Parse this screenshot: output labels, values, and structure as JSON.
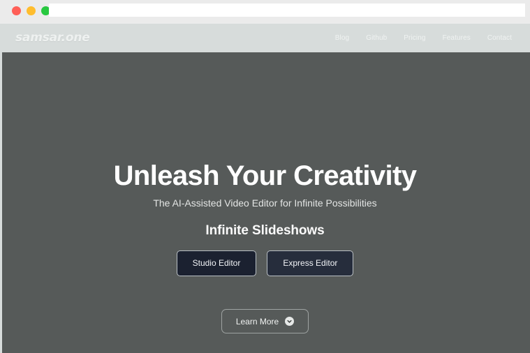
{
  "browser": {
    "traffic_lights": [
      {
        "name": "close",
        "color": "#ff5f57"
      },
      {
        "name": "minimize",
        "color": "#ffbd2e"
      },
      {
        "name": "maximize",
        "color": "#28c840"
      }
    ],
    "address_bar": {
      "value": "",
      "placeholder": ""
    }
  },
  "site": {
    "brand": "samsar.one",
    "nav": [
      {
        "label": "Blog"
      },
      {
        "label": "Github"
      },
      {
        "label": "Pricing"
      },
      {
        "label": "Features"
      },
      {
        "label": "Contact"
      }
    ],
    "nav_bg": "#d7dcdb"
  },
  "hero": {
    "title": "Unleash Your Creativity",
    "subtitle": "The AI-Assisted Video Editor for Infinite Possibilities",
    "tagline": "Infinite Slideshows",
    "background": "#565a59",
    "primary_cta": "Studio Editor",
    "secondary_cta": "Express Editor",
    "learn_more": "Learn More",
    "learn_more_icon": "chevron-down-circle-icon"
  }
}
